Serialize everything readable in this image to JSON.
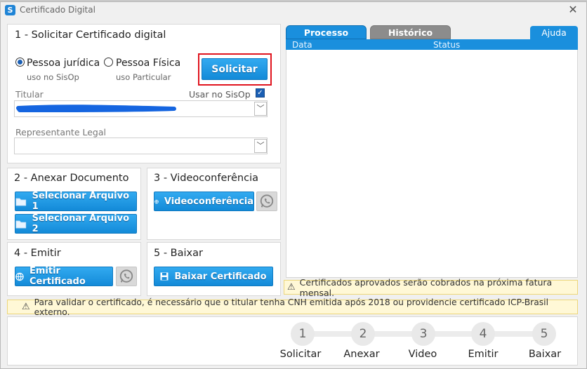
{
  "window": {
    "title": "Certificado Digital",
    "close_glyph": "✕",
    "logo_letter": "S"
  },
  "section1": {
    "title": "1 - Solicitar Certificado digital",
    "radio_juridica": {
      "label": "Pessoa jurídica",
      "sub": "uso no SisOp",
      "selected": true
    },
    "radio_fisica": {
      "label": "Pessoa Física",
      "sub": "uso Particular",
      "selected": false
    },
    "solicitar_label": "Solicitar",
    "titular_label": "Titular",
    "usar_sisop_label": "Usar no SisOp",
    "usar_sisop_checked": true,
    "representante_label": "Representante Legal"
  },
  "section2": {
    "title": "2 - Anexar Documento",
    "btn1": "Selecionar Arquivo 1",
    "btn2": "Selecionar Arquivo 2"
  },
  "section3": {
    "title": "3 - Videoconferência",
    "btn": "Videoconferência"
  },
  "section4": {
    "title": "4 - Emitir",
    "btn": "Emitir Certificado"
  },
  "section5": {
    "title": "5 - Baixar",
    "btn": "Baixar Certificado"
  },
  "tabs": {
    "processo": "Processo",
    "historico": "Histórico",
    "ajuda": "Ajuda"
  },
  "grid": {
    "col_data": "Data",
    "col_status": "Status"
  },
  "warnings": {
    "fatura": "Certificados aprovados serão cobrados na próxima fatura mensal.",
    "cnh": "Para validar o certificado, é necessário que o titular tenha CNH emitida após 2018 ou providencie certificado ICP-Brasil externo."
  },
  "steps": [
    {
      "num": "1",
      "label": "Solicitar"
    },
    {
      "num": "2",
      "label": "Anexar"
    },
    {
      "num": "3",
      "label": "Video"
    },
    {
      "num": "4",
      "label": "Emitir"
    },
    {
      "num": "5",
      "label": "Baixar"
    }
  ],
  "colors": {
    "accent_blue": "#1a8fdd",
    "tab_active": "#1a8fdd",
    "tab_inactive": "#8c8c8c",
    "highlight_red": "#e0141e",
    "warning_bg": "#fff8d6"
  },
  "icons": {
    "folder": "folder-icon",
    "globe": "globe-icon",
    "whatsapp": "whatsapp-icon",
    "save": "save-icon",
    "warning": "warning-icon",
    "chevron": "chevron-down-icon"
  }
}
